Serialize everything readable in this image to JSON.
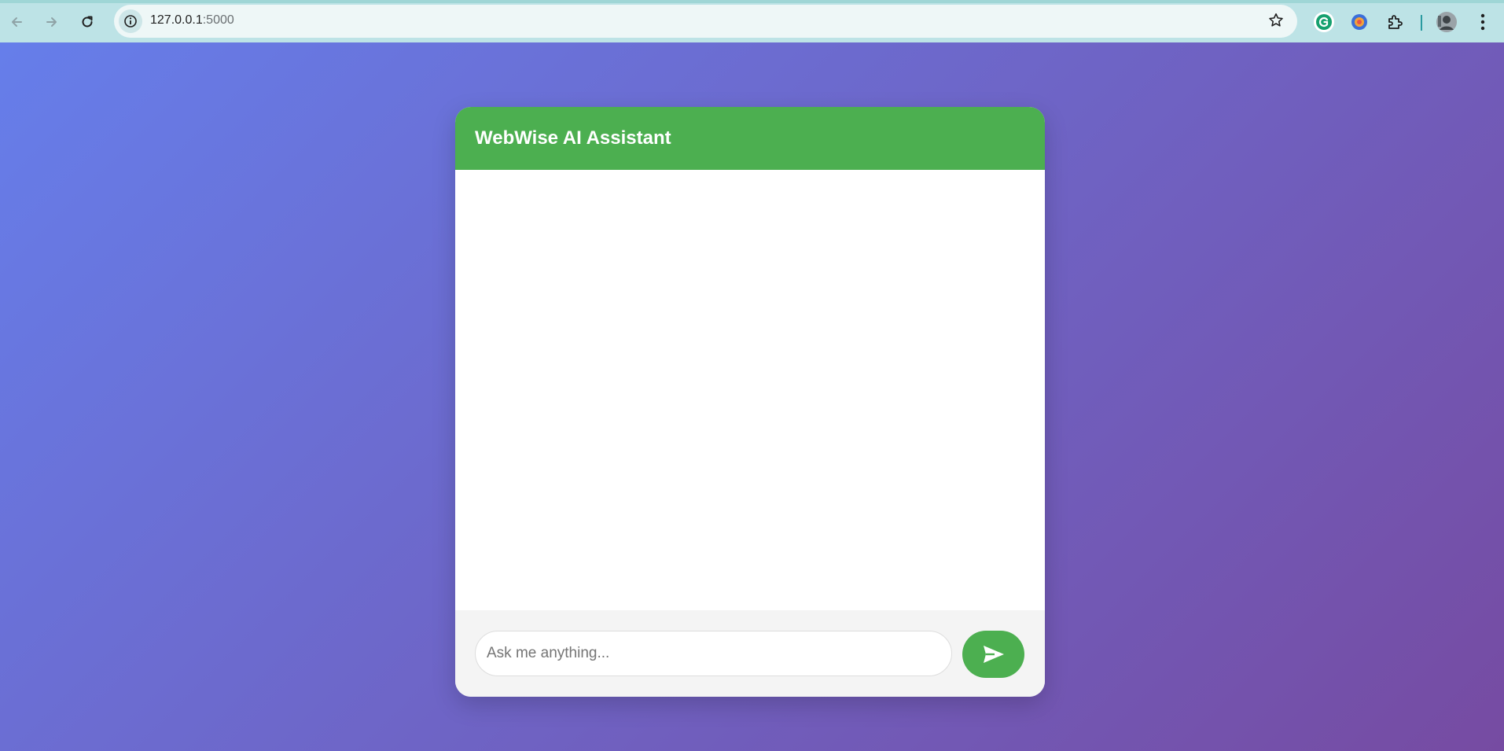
{
  "browser": {
    "url_host": "127.0.0.1",
    "url_port": ":5000",
    "back_icon": "arrow-left-icon",
    "forward_icon": "arrow-right-icon",
    "reload_icon": "reload-icon",
    "site_info_icon": "info-icon",
    "bookmark_icon": "star-icon",
    "extensions": [
      "grammarly-icon",
      "color-extension-icon",
      "puzzle-extensions-icon"
    ],
    "profile_icon": "avatar",
    "menu_icon": "kebab-menu-icon"
  },
  "theme": {
    "background_gradient": [
      "#667eea",
      "#764ba2"
    ],
    "accent": "#4caf50",
    "card_background": "#ffffff",
    "input_area_background": "#f4f4f4"
  },
  "chat": {
    "title": "WebWise AI Assistant",
    "messages": [],
    "input_value": "",
    "input_placeholder": "Ask me anything...",
    "send_icon": "send-icon"
  }
}
